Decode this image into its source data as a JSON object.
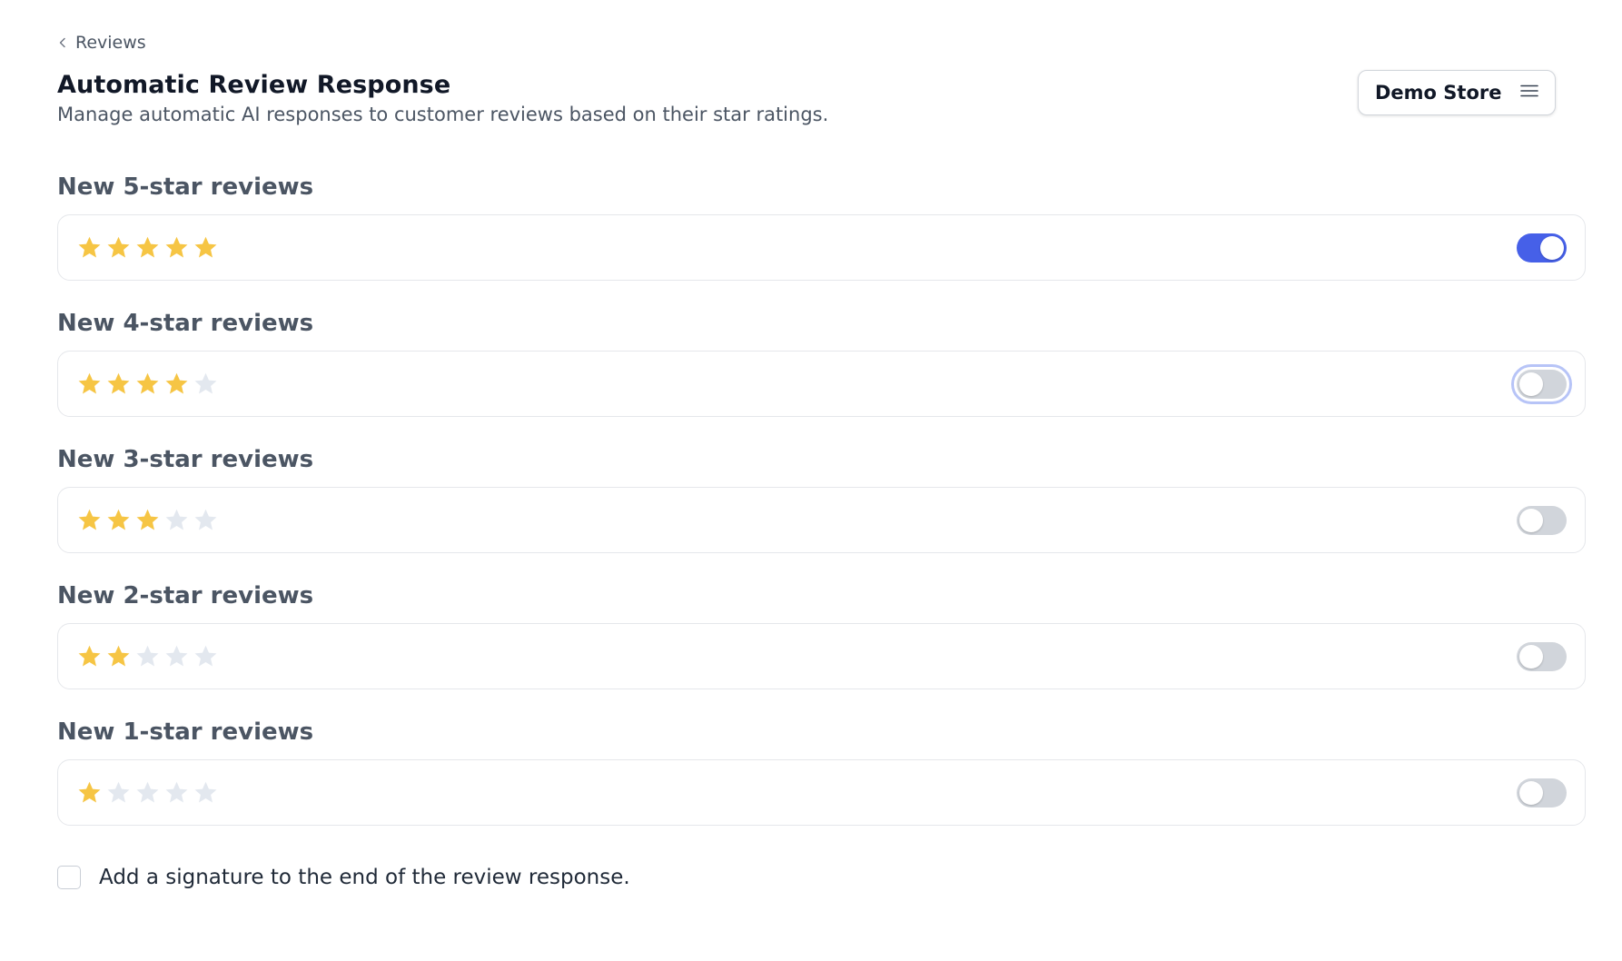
{
  "breadcrumb": {
    "label": "Reviews"
  },
  "header": {
    "title": "Automatic Review Response",
    "subtitle": "Manage automatic AI responses to customer reviews based on their star ratings."
  },
  "store_selector": {
    "label": "Demo Store",
    "icon": "menu-icon"
  },
  "colors": {
    "star_filled": "#f6c544",
    "star_empty": "#e3e8ef",
    "toggle_on": "#4660e8",
    "toggle_off": "#d1d5db"
  },
  "ratings": [
    {
      "label": "New 5-star reviews",
      "stars": 5,
      "enabled": true,
      "focused": false
    },
    {
      "label": "New 4-star reviews",
      "stars": 4,
      "enabled": false,
      "focused": true
    },
    {
      "label": "New 3-star reviews",
      "stars": 3,
      "enabled": false,
      "focused": false
    },
    {
      "label": "New 2-star reviews",
      "stars": 2,
      "enabled": false,
      "focused": false
    },
    {
      "label": "New 1-star reviews",
      "stars": 1,
      "enabled": false,
      "focused": false
    }
  ],
  "signature": {
    "label": "Add a signature to the end of the review response.",
    "checked": false
  }
}
